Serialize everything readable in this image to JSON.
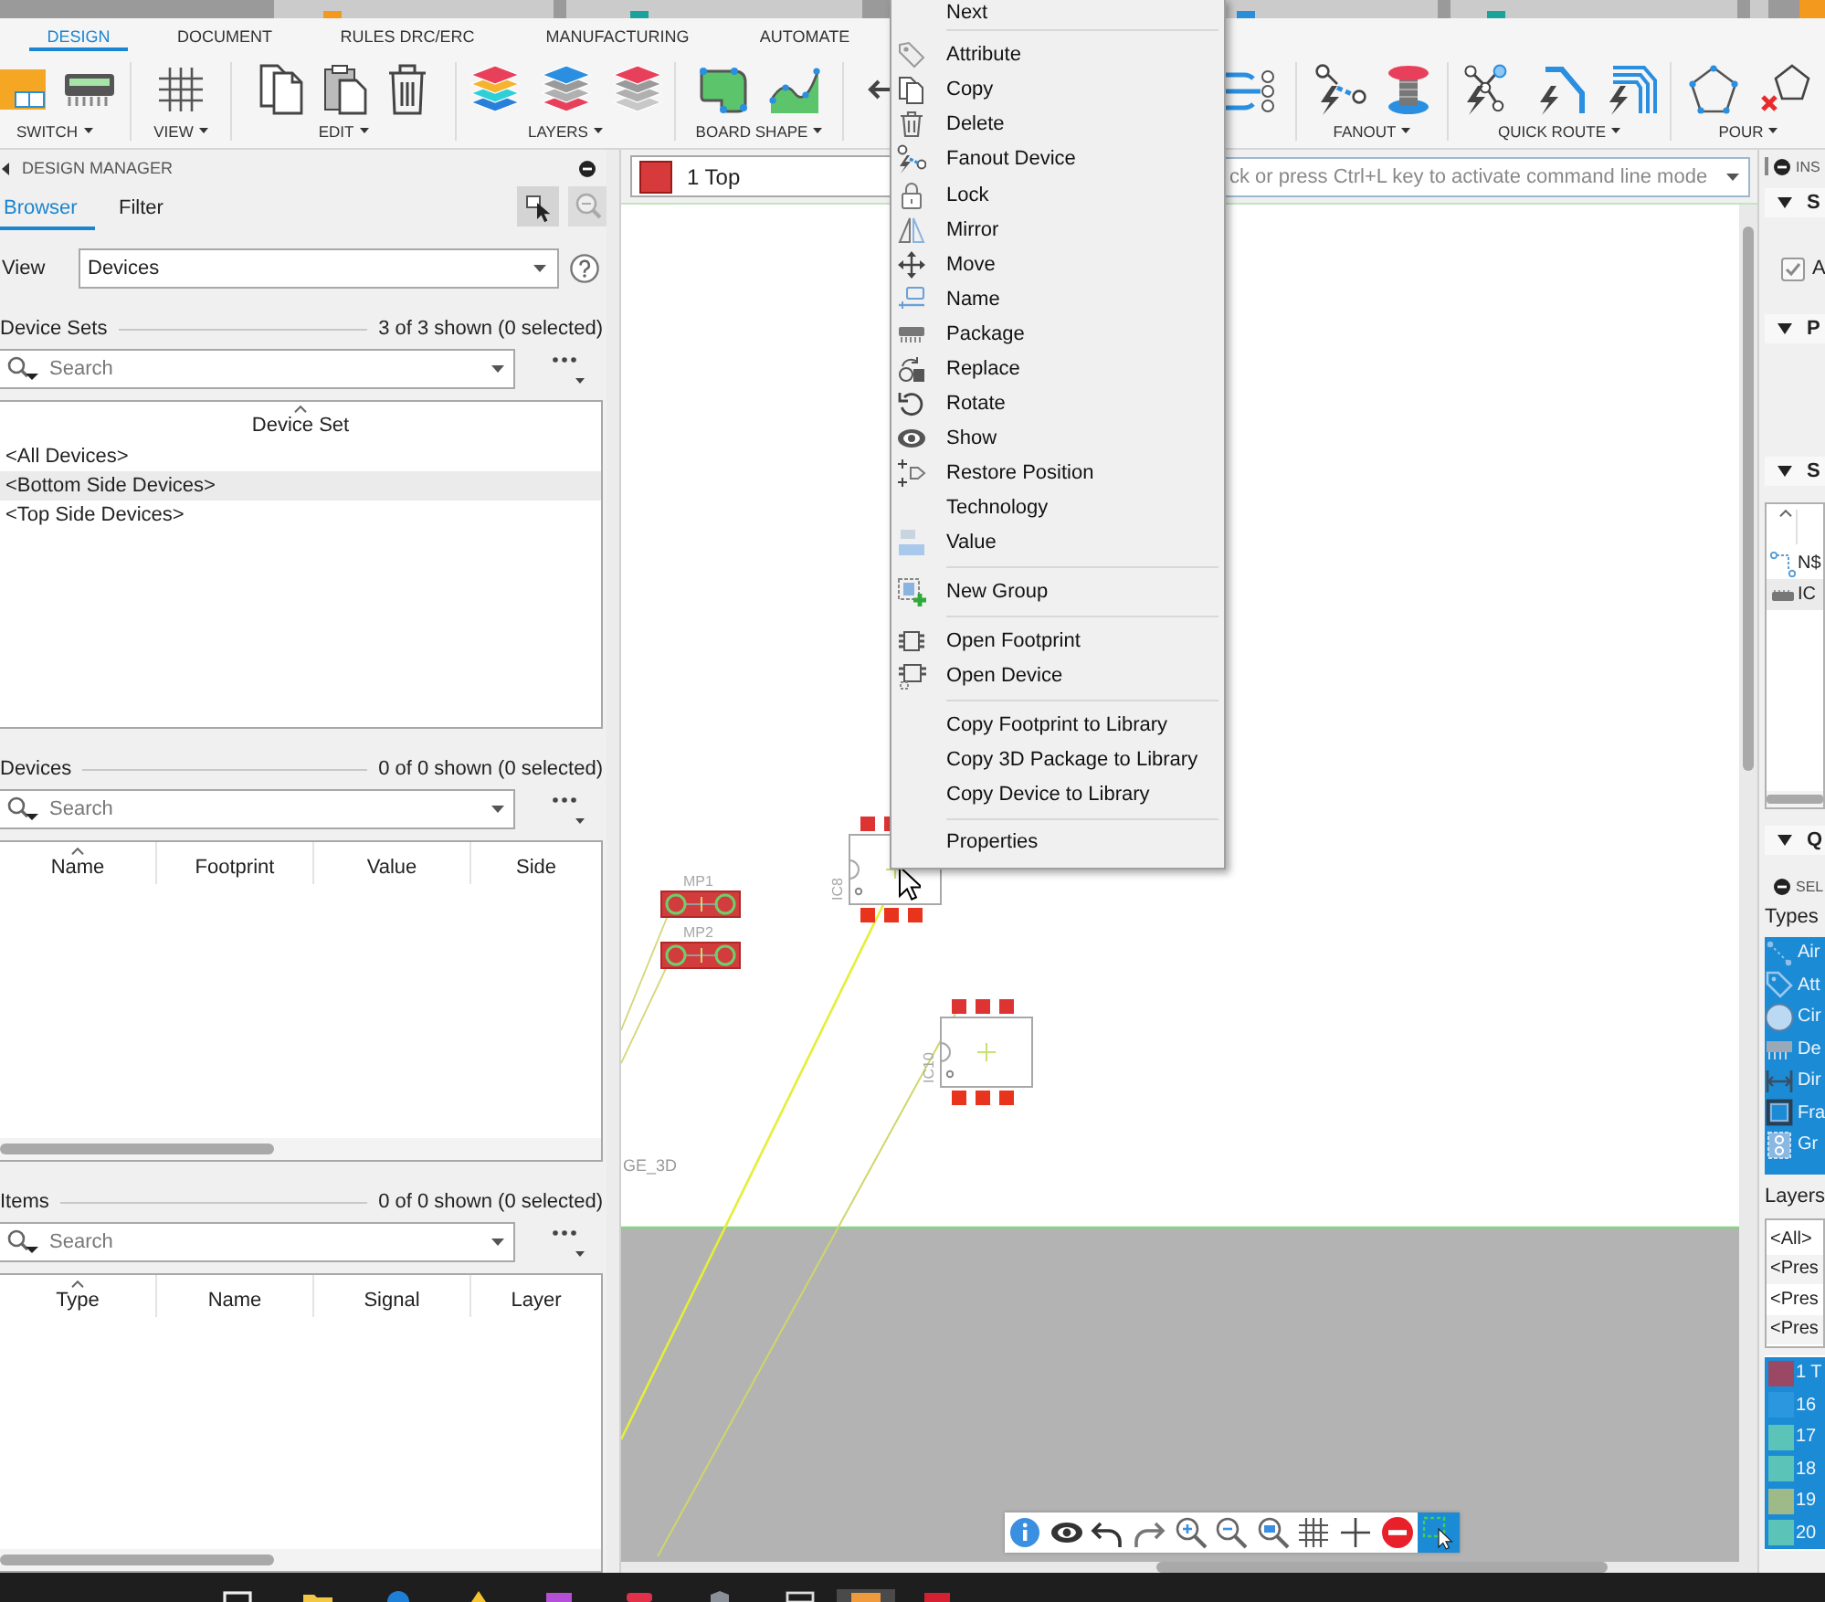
{
  "ribbon": {
    "tabs": [
      {
        "label": "DESIGN",
        "selected": true
      },
      {
        "label": "DOCUMENT",
        "selected": false
      },
      {
        "label": "RULES DRC/ERC",
        "selected": false
      },
      {
        "label": "MANUFACTURING",
        "selected": false
      },
      {
        "label": "AUTOMATE",
        "selected": false
      }
    ],
    "groups": [
      {
        "label": "SWITCH"
      },
      {
        "label": "VIEW"
      },
      {
        "label": "EDIT"
      },
      {
        "label": "LAYERS"
      },
      {
        "label": "BOARD SHAPE"
      },
      {
        "label": "FANOUT"
      },
      {
        "label": "QUICK ROUTE"
      },
      {
        "label": "POUR"
      }
    ]
  },
  "design_manager": {
    "title": "DESIGN MANAGER",
    "tabs": [
      {
        "label": "Browser",
        "selected": true
      },
      {
        "label": "Filter",
        "selected": false
      }
    ],
    "view": {
      "label": "View",
      "value": "Devices"
    },
    "device_sets": {
      "title": "Device Sets",
      "count": "3 of 3 shown (0 selected)",
      "search": {
        "placeholder": "Search"
      },
      "columns": [
        {
          "label": "Device Set",
          "sorted": true
        }
      ],
      "rows": [
        {
          "label": "<All Devices>",
          "hovered": false
        },
        {
          "label": "<Bottom Side Devices>",
          "hovered": true
        },
        {
          "label": "<Top Side Devices>",
          "hovered": false
        }
      ]
    },
    "devices": {
      "title": "Devices",
      "count": "0 of 0 shown (0 selected)",
      "search": {
        "placeholder": "Search"
      },
      "columns": [
        {
          "label": "Name",
          "sorted": true
        },
        {
          "label": "Footprint",
          "sorted": false
        },
        {
          "label": "Value",
          "sorted": false
        },
        {
          "label": "Side",
          "sorted": false
        }
      ]
    },
    "items": {
      "title": "Items",
      "count": "0 of 0 shown (0 selected)",
      "search": {
        "placeholder": "Search"
      },
      "columns": [
        {
          "label": "Type",
          "sorted": true
        },
        {
          "label": "Name",
          "sorted": false
        },
        {
          "label": "Signal",
          "sorted": false
        },
        {
          "label": "Layer",
          "sorted": false
        }
      ]
    }
  },
  "canvas": {
    "layer": {
      "value": "1 Top"
    },
    "command_line": {
      "placeholder": "ck or press Ctrl+L key to activate command line mode"
    },
    "parts": [
      {
        "name": "MP1",
        "kind": "jumper"
      },
      {
        "name": "MP2",
        "kind": "jumper"
      },
      {
        "name": "IC8",
        "kind": "ic"
      },
      {
        "name": "IC10",
        "kind": "ic"
      }
    ],
    "label": "GE_3D",
    "tools": [
      {
        "selected": false
      },
      {
        "selected": false
      },
      {
        "selected": false
      },
      {
        "selected": false
      },
      {
        "selected": false
      },
      {
        "selected": false
      },
      {
        "selected": false
      },
      {
        "selected": false
      },
      {
        "selected": false
      },
      {
        "selected": false
      },
      {
        "selected": true
      }
    ]
  },
  "context_menu": {
    "sections": [
      [
        "Next"
      ],
      [
        "Attribute",
        "Copy",
        "Delete",
        "Fanout Device",
        "Lock",
        "Mirror",
        "Move",
        "Name",
        "Package",
        "Replace",
        "Rotate",
        "Show",
        "Restore Position",
        "Technology",
        "Value"
      ],
      [
        "New Group"
      ],
      [
        "Open Footprint",
        "Open Device"
      ],
      [
        "Copy Footprint to Library",
        "Copy 3D Package to Library",
        "Copy Device to Library"
      ],
      [
        "Properties"
      ]
    ]
  },
  "inspector": {
    "title": "INS",
    "sections": [
      {
        "title": "S",
        "expanded": true,
        "checks": [
          {
            "label": "A",
            "checked": true
          }
        ]
      },
      {
        "title": "P",
        "expanded": true
      },
      {
        "title": "S",
        "expanded": true,
        "items": [
          {
            "label": "N$",
            "hovered": false
          },
          {
            "label": "IC",
            "hovered": true
          }
        ]
      },
      {
        "title": "Q",
        "expanded": true
      }
    ]
  },
  "selection_filter": {
    "title": "SEL",
    "types_title": "Types",
    "types": [
      {
        "label": "Air",
        "selected": true
      },
      {
        "label": "Att",
        "selected": true
      },
      {
        "label": "Cir",
        "selected": true
      },
      {
        "label": "De",
        "selected": true
      },
      {
        "label": "Dir",
        "selected": true
      },
      {
        "label": "Fra",
        "selected": true
      },
      {
        "label": "Gr",
        "selected": true
      }
    ],
    "layers_title": "Layers",
    "presets": [
      {
        "label": "<All>",
        "selected": false
      },
      {
        "label": "<Pres",
        "selected": false
      },
      {
        "label": "<Pres",
        "selected": false
      },
      {
        "label": "<Pres",
        "selected": false
      }
    ],
    "layers": [
      {
        "label": "1 T",
        "color": "#9b4865",
        "selected": true
      },
      {
        "label": "16",
        "color": "#2b97de",
        "selected": true
      },
      {
        "label": "17",
        "color": "#5cc3b8",
        "selected": true
      },
      {
        "label": "18",
        "color": "#5cc3b8",
        "selected": true
      },
      {
        "label": "19",
        "color": "#9dba88",
        "selected": true
      },
      {
        "label": "20",
        "color": "#5cc3b8",
        "selected": true
      }
    ]
  }
}
